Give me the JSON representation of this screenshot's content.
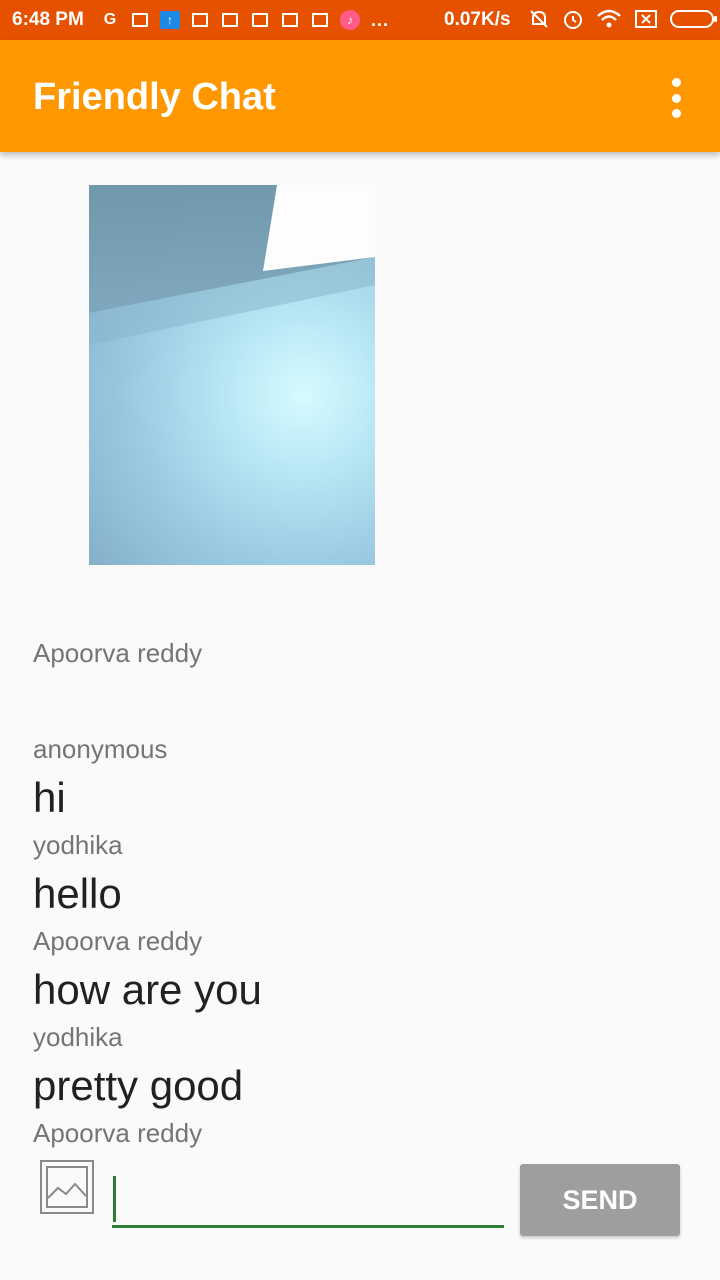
{
  "status_bar": {
    "time": "6:48 PM",
    "network_speed": "0.07K/s",
    "overflow_dots": "...",
    "icons": [
      "google-icon",
      "gmail-icon",
      "upload-icon",
      "gmail-icon",
      "gmail-icon",
      "gmail-icon",
      "gmail-icon",
      "gmail-icon",
      "music-icon",
      "mute-icon",
      "alarm-icon",
      "wifi-icon",
      "sim-icon",
      "battery-icon"
    ]
  },
  "app_bar": {
    "title": "Friendly Chat",
    "menu_icon": "more-vert-icon",
    "color": "#ff9800"
  },
  "messages": [
    {
      "type": "image",
      "author": "Apoorva reddy"
    },
    {
      "type": "text",
      "author": "anonymous",
      "text": "hi"
    },
    {
      "type": "text",
      "author": "yodhika",
      "text": "hello"
    },
    {
      "type": "text",
      "author": "Apoorva reddy",
      "text": "how are you"
    },
    {
      "type": "text",
      "author": "yodhika",
      "text": "pretty good"
    },
    {
      "type": "text",
      "author": "Apoorva reddy",
      "text": ""
    }
  ],
  "composer": {
    "input_value": "",
    "send_label": "SEND",
    "photo_picker_icon": "image-icon",
    "underline_color": "#2e7d32"
  }
}
